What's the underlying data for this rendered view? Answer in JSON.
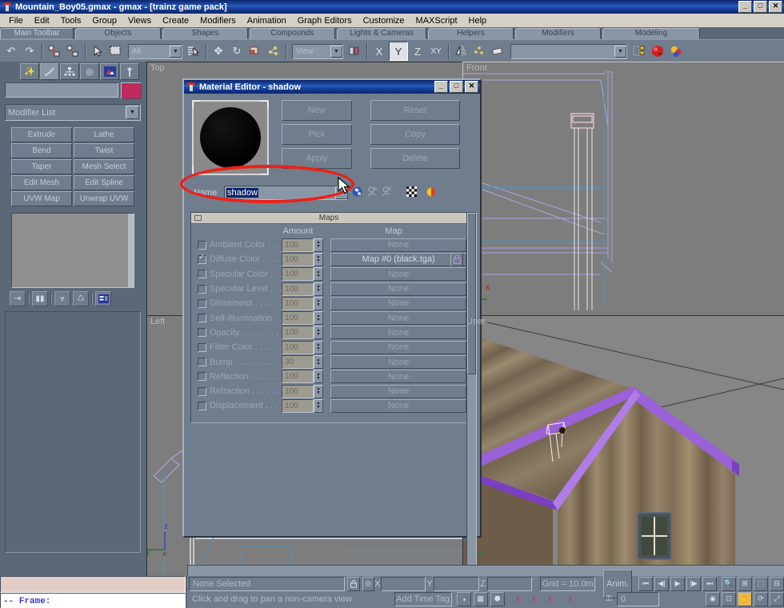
{
  "window": {
    "title": "Mountain_Boy05.gmax - gmax - [trainz game pack]",
    "minimize": "_",
    "maximize": "□",
    "close": "✕",
    "app_icon": "gmax-icon"
  },
  "menubar": {
    "items": [
      "File",
      "Edit",
      "Tools",
      "Group",
      "Views",
      "Create",
      "Modifiers",
      "Animation",
      "Graph Editors",
      "Customize",
      "MAXScript",
      "Help"
    ]
  },
  "toolbar_tabs": {
    "items": [
      "Main Toolbar",
      "Objects",
      "Shapes",
      "Compounds",
      "Lights & Cameras",
      "Helpers",
      "Modifiers",
      "Modeling"
    ],
    "selected": "Main Toolbar"
  },
  "main_toolbar": {
    "selection_filter": "All",
    "coord_system": "View",
    "named_selection": "",
    "axis_constraints": [
      "X",
      "Y",
      "Z",
      "XY"
    ],
    "active_axis": "Y",
    "icons": [
      "undo-icon",
      "redo-icon",
      "select-link-icon",
      "unlink-icon",
      "bind-space-warp-icon",
      "select-object-icon",
      "select-region-icon",
      "select-by-name-icon",
      "select-and-move-icon",
      "select-and-rotate-icon",
      "select-and-scale-icon",
      "use-pivot-icon",
      "mirror-icon",
      "align-icon",
      "array-icon",
      "layer-manager-icon",
      "material-editor-icon",
      "render-scene-icon"
    ]
  },
  "command_panel": {
    "tabs": [
      "create-tab",
      "modify-tab",
      "hierarchy-tab",
      "motion-tab",
      "display-tab",
      "utilities-tab"
    ],
    "selected_tab": "modify-tab",
    "object_name": "",
    "object_color": "#c12a5e",
    "modifier_list_label": "Modifier List",
    "modifier_buttons": [
      "Extrude",
      "Lathe",
      "Bend",
      "Twist",
      "Taper",
      "Mesh Select",
      "Edit Mesh",
      "Edit Spline",
      "UVW Map",
      "Unwrap UVW"
    ],
    "stack_icons": [
      "pin-stack-icon",
      "show-end-result-icon",
      "make-unique-icon",
      "remove-modifier-icon",
      "configure-sets-icon"
    ]
  },
  "viewports": [
    {
      "label": "Top",
      "name": "viewport-top"
    },
    {
      "label": "Front",
      "name": "viewport-front"
    },
    {
      "label": "Left",
      "name": "viewport-left"
    },
    {
      "label": "User",
      "name": "viewport-user"
    }
  ],
  "axis_tripod": {
    "x": "x",
    "y": "y",
    "z": "z"
  },
  "material_editor": {
    "title": "Material Editor - shadow",
    "minimize": "_",
    "maximize": "□",
    "close": "✕",
    "buttons": [
      "New",
      "Pick",
      "Apply",
      "Reset",
      "Copy",
      "Delete"
    ],
    "name_label": "Name",
    "name_value": "shadow",
    "toolbar_icons": [
      "assign-material-icon",
      "put-to-library-icon",
      "get-material-icon",
      "background-checker-icon",
      "color-sphere-icon"
    ],
    "rollout_title": "Maps",
    "column_amount": "Amount",
    "column_map": "Map",
    "lock_icon": "lock-icon",
    "maps": [
      {
        "label": "Ambient Color . . . . .",
        "checked": false,
        "amount": "100",
        "map": "None"
      },
      {
        "label": "Diffuse Color . . . . . . .",
        "checked": true,
        "amount": "100",
        "map": "Map #0 (black.tga)"
      },
      {
        "label": "Specular Color  . . . .",
        "checked": false,
        "amount": "100",
        "map": "None"
      },
      {
        "label": "Specular Level . . . .",
        "checked": false,
        "amount": "100",
        "map": "None"
      },
      {
        "label": "Glossiness . . . . . . . .",
        "checked": false,
        "amount": "100",
        "map": "None"
      },
      {
        "label": "Self-Illumination . . . .",
        "checked": false,
        "amount": "100",
        "map": "None"
      },
      {
        "label": "Opacity . . . . . . . . . . .",
        "checked": false,
        "amount": "100",
        "map": "None"
      },
      {
        "label": "Filter Color . . . . . . . .",
        "checked": false,
        "amount": "100",
        "map": "None"
      },
      {
        "label": "Bump . . . . . . . . . . . .",
        "checked": false,
        "amount": "30",
        "map": "None"
      },
      {
        "label": "Reflection . . . . . . . . .",
        "checked": false,
        "amount": "100",
        "map": "None"
      },
      {
        "label": "Refraction . . . . . . . . .",
        "checked": false,
        "amount": "100",
        "map": "None"
      },
      {
        "label": "Displacement . . . . . .",
        "checked": false,
        "amount": "100",
        "map": "None"
      }
    ]
  },
  "annotation": {
    "shape": "red-ellipse-highlight",
    "color": "#ee2017"
  },
  "listener": {
    "line": "--  Frame:"
  },
  "status_bar": {
    "selection": "None Selected",
    "prompt": "Click and drag to pan a non-camera view",
    "x_label": "X",
    "x_value": "",
    "y_label": "Y",
    "y_value": "",
    "z_label": "Z",
    "z_value": "",
    "grid": "Grid = 10.0m",
    "add_time_tag": "Add Time Tag",
    "animate": "Anim.",
    "frame_value": "0",
    "lock_icon": "selection-lock-icon",
    "nav_icons": [
      "go-to-start-icon",
      "previous-frame-icon",
      "play-animation-icon",
      "next-frame-icon",
      "go-to-end-icon",
      "key-mode-icon"
    ],
    "view_icons": [
      "zoom-icon",
      "zoom-all-icon",
      "zoom-extents-icon",
      "zoom-region-icon",
      "field-of-view-icon",
      "pan-icon",
      "arc-rotate-icon",
      "min-max-toggle-icon"
    ],
    "active_view_tool": "pan-icon"
  }
}
